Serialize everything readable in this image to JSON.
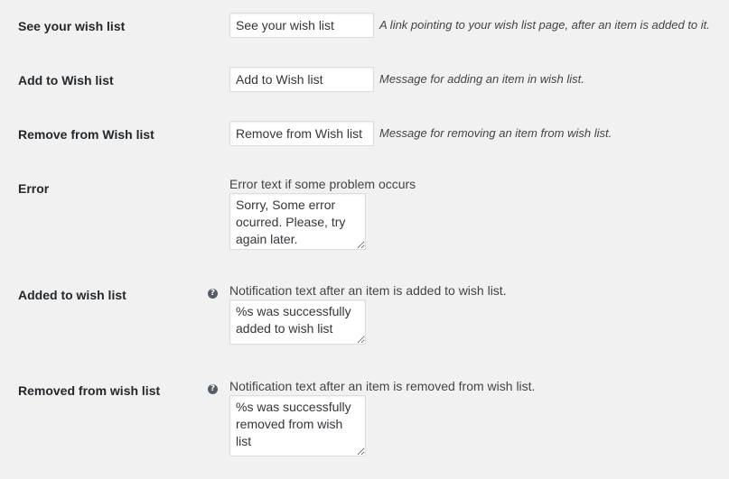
{
  "settings": {
    "see_wishlist": {
      "label": "See your wish list",
      "value": "See your wish list",
      "description": "A link pointing to your wish list page, after an item is added to it."
    },
    "add_to_wishlist": {
      "label": "Add to Wish list",
      "value": "Add to Wish list",
      "description": "Message for adding an item in wish list."
    },
    "remove_from_wishlist": {
      "label": "Remove from Wish list",
      "value": "Remove from Wish list",
      "description": "Message for removing an item from wish list."
    },
    "error": {
      "label": "Error",
      "description": "Error text if some problem occurs",
      "value": "Sorry, Some error ocurred. Please, try again later."
    },
    "added_to_wishlist": {
      "label": "Added to wish list",
      "help_icon": "question-circle-icon",
      "description": "Notification text after an item is added to wish list.",
      "value": "%s was successfully added to wish list"
    },
    "removed_from_wishlist": {
      "label": "Removed from wish list",
      "help_icon": "question-circle-icon",
      "description": "Notification text after an item is removed from wish list.",
      "value": "%s was successfully removed from wish list"
    }
  },
  "help_glyph": "?"
}
